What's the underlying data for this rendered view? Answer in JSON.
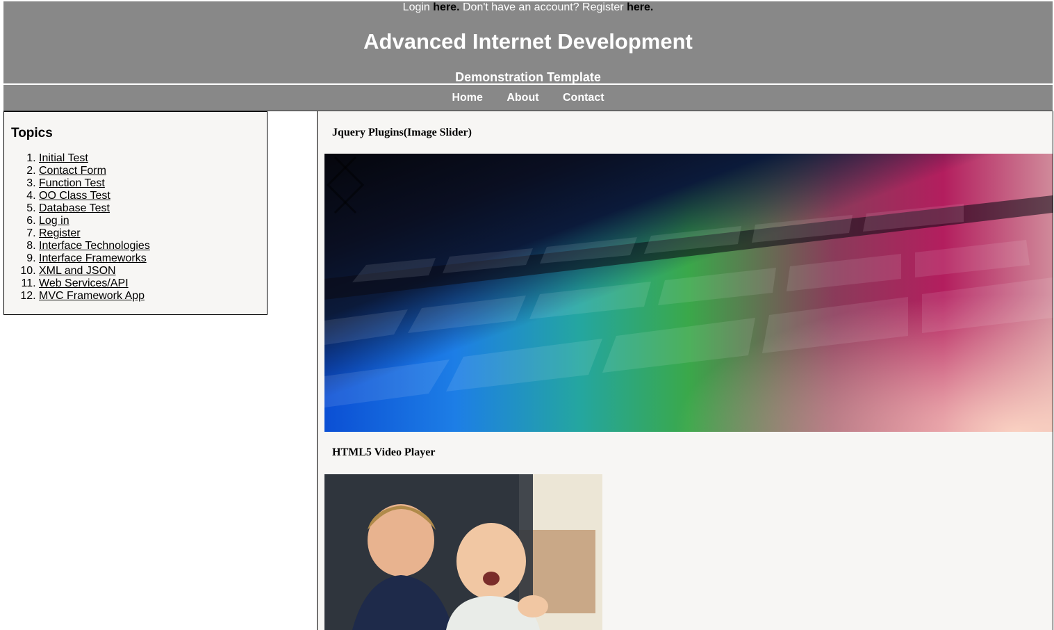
{
  "header": {
    "login_prefix": "Login",
    "login_link": "here.",
    "register_prefix": "Don't have an account? Register",
    "register_link": "here.",
    "title": "Advanced Internet Development",
    "subtitle": "Demonstration Template"
  },
  "nav": {
    "items": [
      {
        "label": "Home"
      },
      {
        "label": "About"
      },
      {
        "label": "Contact"
      }
    ]
  },
  "sidebar": {
    "heading": "Topics",
    "items": [
      {
        "label": "Initial Test"
      },
      {
        "label": "Contact Form"
      },
      {
        "label": "Function Test"
      },
      {
        "label": "OO Class Test"
      },
      {
        "label": "Database Test"
      },
      {
        "label": "Log in"
      },
      {
        "label": "Register"
      },
      {
        "label": "Interface Technologies"
      },
      {
        "label": "Interface Frameworks"
      },
      {
        "label": "XML and JSON"
      },
      {
        "label": "Web Services/API"
      },
      {
        "label": "MVC Framework App"
      }
    ]
  },
  "main": {
    "slider_heading": "Jquery Plugins(Image Slider)",
    "slider_image": "keyboard-photo",
    "video_heading": "HTML5 Video Player",
    "video_thumbnail": "children-video-frame"
  }
}
